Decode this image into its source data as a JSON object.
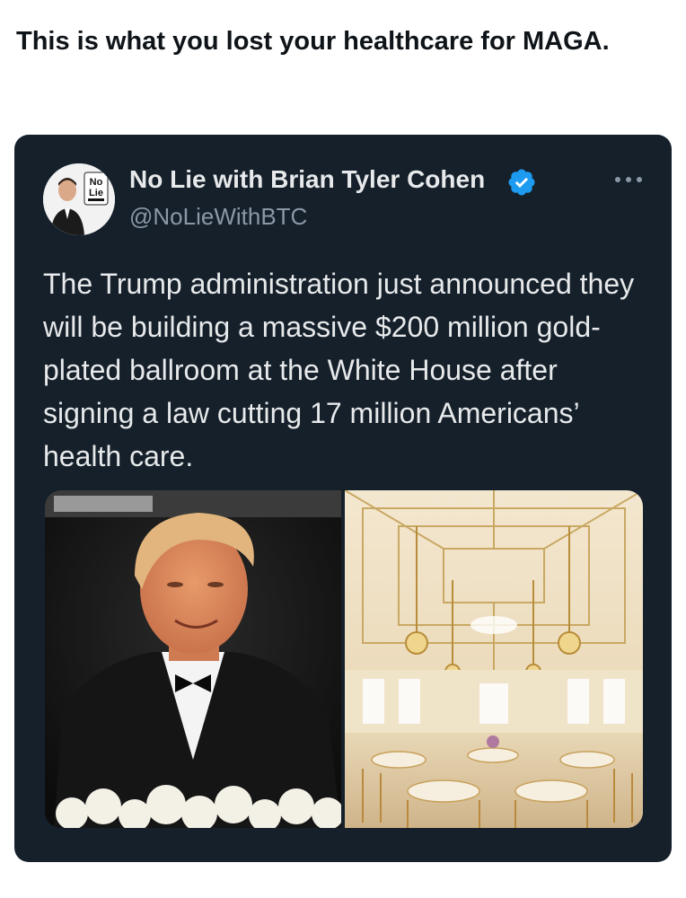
{
  "post": {
    "caption": "This is what you lost your healthcare for MAGA."
  },
  "quoted_tweet": {
    "author_name": "No Lie with Brian Tyler Cohen",
    "handle": "@NoLieWithBTC",
    "verified": true,
    "avatar_logo_text": "No Lie",
    "text": "The Trump administration just announced they will be building a massive $200 million gold-plated ballroom at the White House after signing a law cutting 17 million Americans’ health care.",
    "media": [
      {
        "description_icon": "photo-icon",
        "kind": "portrait-photo"
      },
      {
        "description_icon": "photo-icon",
        "kind": "ballroom-rendering"
      }
    ]
  },
  "colors": {
    "card_background": "#15202b",
    "primary_text": "#e7e9ea",
    "secondary_text": "#8b98a5",
    "verified_badge": "#1d9bf0"
  }
}
